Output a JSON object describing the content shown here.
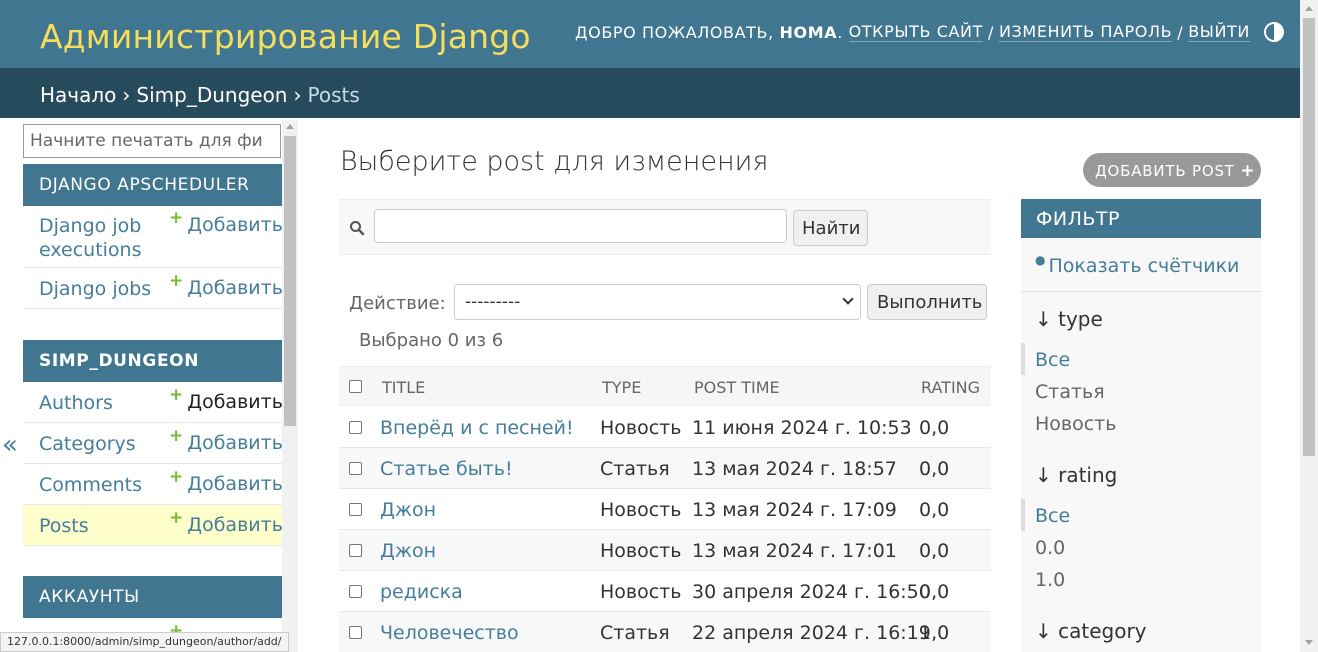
{
  "header": {
    "brand": "Администрирование Django",
    "welcome": "Добро пожаловать,",
    "user": "HOMA",
    "view_site": "Открыть сайт",
    "change_password": "Изменить пароль",
    "logout": "Выйти",
    "sep": "/"
  },
  "breadcrumbs": {
    "home": "Начало",
    "app": "Simp_Dungeon",
    "current": "Posts",
    "arrow": "›"
  },
  "sidebar": {
    "filter_placeholder": "Начните печатать для фи",
    "collapse": "«",
    "add_label": "Добавить",
    "plus": "+",
    "modules": [
      {
        "caption": "Django APScheduler",
        "models": [
          "Django job executions",
          "Django jobs"
        ]
      },
      {
        "caption": "Simp_Dungeon",
        "models": [
          "Authors",
          "Categorys",
          "Comments",
          "Posts"
        ]
      },
      {
        "caption": "Аккаунты",
        "models": []
      }
    ]
  },
  "main": {
    "title": "Выберите post для изменения",
    "add_button": "Добавить post",
    "add_plus": "+",
    "search_button": "Найти",
    "search_value": "",
    "action_label": "Действие:",
    "action_value": "---------",
    "run_button": "Выполнить",
    "selected_count": "Выбрано 0 из 6",
    "columns": [
      "Title",
      "Type",
      "Post time",
      "Rating"
    ],
    "rows": [
      {
        "title": "Вперёд и с песней!",
        "type": "Новость",
        "time": "11 июня 2024 г. 10:53",
        "rating": "0,0"
      },
      {
        "title": "Статье быть!",
        "type": "Статья",
        "time": "13 мая 2024 г. 18:57",
        "rating": "0,0"
      },
      {
        "title": "Джон",
        "type": "Новость",
        "time": "13 мая 2024 г. 17:09",
        "rating": "0,0"
      },
      {
        "title": "Джон",
        "type": "Новость",
        "time": "13 мая 2024 г. 17:01",
        "rating": "0,0"
      },
      {
        "title": "редиска",
        "type": "Новость",
        "time": "30 апреля 2024 г. 16:50",
        "rating": "0,0"
      },
      {
        "title": "Человечество",
        "type": "Статья",
        "time": "22 апреля 2024 г. 16:19",
        "rating": "1,0"
      }
    ]
  },
  "filter": {
    "title": "Фильтр",
    "show_counts": "Показать счётчики",
    "groups": [
      {
        "heading": "↓ type",
        "choices": [
          "Все",
          "Статья",
          "Новость"
        ]
      },
      {
        "heading": "↓ rating",
        "choices": [
          "Все",
          "0.0",
          "1.0"
        ]
      },
      {
        "heading": "↓ category",
        "choices": []
      }
    ]
  },
  "status_bar": "127.0.0.1:8000/admin/simp_dungeon/author/add/",
  "colors": {
    "header": "#417690",
    "breadcrumbs": "#264b5d",
    "brand_yellow": "#f5dd5d",
    "link": "#447e9b",
    "add_green": "#70bf2b",
    "current_row": "#ffffcc"
  }
}
